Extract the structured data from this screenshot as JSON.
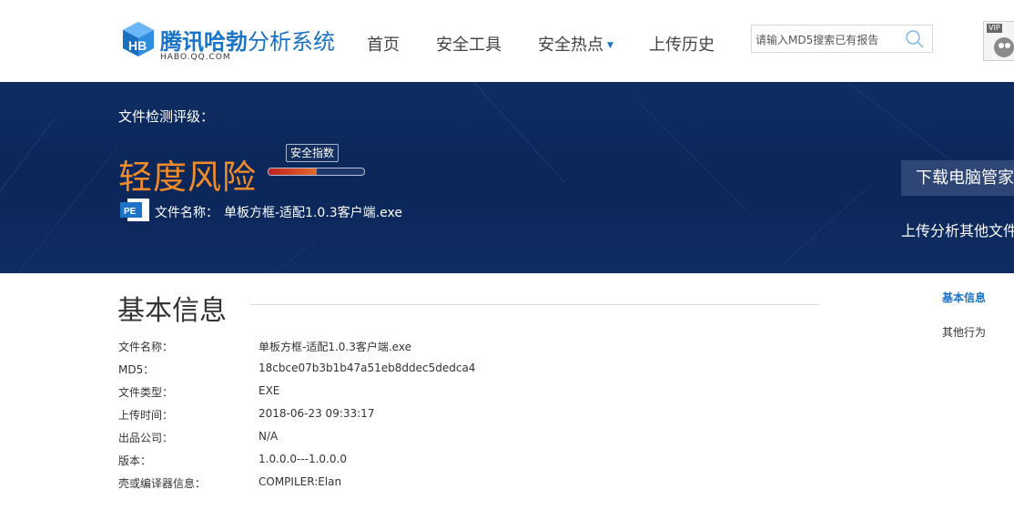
{
  "header": {
    "logo_title_bold": "腾讯哈勃",
    "logo_title_light": "分析系统",
    "logo_sub": "HABO.QQ.COM",
    "nav": [
      {
        "label": "首页"
      },
      {
        "label": "安全工具"
      },
      {
        "label": "安全热点"
      },
      {
        "label": "上传历史"
      }
    ],
    "search_placeholder": "请输入MD5搜索已有报告",
    "avatar_badge": "VIP"
  },
  "banner": {
    "rating_label": "文件检测评级：",
    "risk_level": "轻度风险",
    "score_tip": "安全指数",
    "score_fraction": 0.5,
    "pe_badge": "PE",
    "file_name_label": "文件名称：",
    "file_name": "单板方框-适配1.0.3客户端.exe",
    "download_button": "下载电脑管家",
    "upload_other": "上传分析其他文件"
  },
  "main": {
    "section_title": "基本信息",
    "rows": [
      {
        "key": "文件名称：",
        "value": "单板方框-适配1.0.3客户端.exe"
      },
      {
        "key": "MD5：",
        "value": "18cbce07b3b1b47a51eb8ddec5dedca4"
      },
      {
        "key": "文件类型：",
        "value": "EXE"
      },
      {
        "key": "上传时间：",
        "value": "2018-06-23 09:33:17"
      },
      {
        "key": "出品公司：",
        "value": "N/A"
      },
      {
        "key": "版本：",
        "value": "1.0.0.0---1.0.0.0"
      },
      {
        "key": "壳或编译器信息：",
        "value": "COMPILER:Elan"
      }
    ]
  },
  "side_nav": [
    {
      "label": "基本信息"
    },
    {
      "label": "其他行为"
    }
  ],
  "colors": {
    "brand": "#1a73c6",
    "banner": "#0b2658",
    "risk": "#f08c2a"
  },
  "icons": [
    "habo-logo-icon",
    "search-icon",
    "caret-down-icon",
    "pe-file-icon"
  ]
}
